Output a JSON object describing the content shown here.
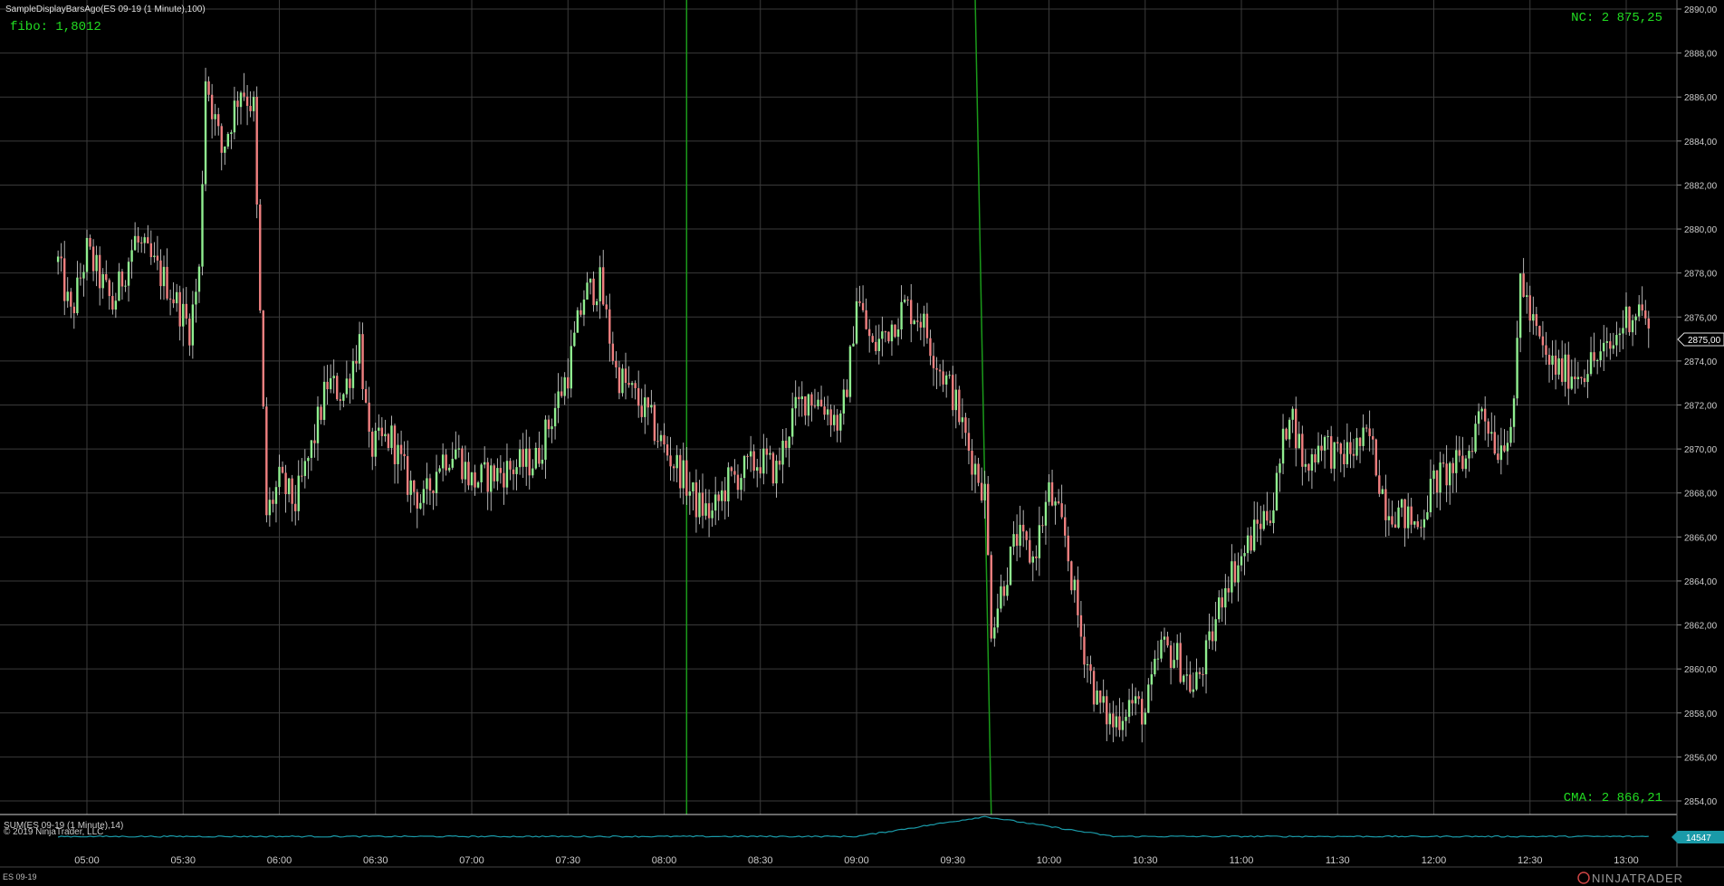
{
  "header": {
    "indicator_title": "SampleDisplayBarsAgo(ES 09-19 (1 Minute),100)",
    "fibo_label": "fibo: 1,8012"
  },
  "labels": {
    "nc": "NC: 2 875,25",
    "cma": "CMA: 2 866,21",
    "current_price": "2875,00"
  },
  "lower_panel": {
    "title": "SUM(ES 09-19 (1 Minute),14)",
    "copyright": "© 2019 NinjaTrader, LLC",
    "current_value": "14547"
  },
  "footer": {
    "instrument": "ES 09-19",
    "brand": "NINJATRADER"
  },
  "colors": {
    "background": "#000000",
    "grid": "#3a3a3a",
    "up_candle": "#90ee90",
    "down_candle": "#f08080",
    "wick": "#dddddd",
    "green_text": "#22dd22",
    "green_line": "#1a9a1a",
    "sum_line": "#1a9aa8",
    "axis_text": "#cccccc"
  },
  "price_axis": {
    "ticks": [
      "2890,00",
      "2888,00",
      "2886,00",
      "2884,00",
      "2882,00",
      "2880,00",
      "2878,00",
      "2876,00",
      "2874,00",
      "2872,00",
      "2870,00",
      "2868,00",
      "2866,00",
      "2864,00",
      "2862,00",
      "2860,00",
      "2858,00",
      "2856,00",
      "2854,00"
    ],
    "min": 2854,
    "max": 2890
  },
  "time_axis": {
    "ticks": [
      "05:00",
      "05:30",
      "06:00",
      "06:30",
      "07:00",
      "07:30",
      "08:00",
      "08:30",
      "09:00",
      "09:30",
      "10:00",
      "10:30",
      "11:00",
      "11:30",
      "12:00",
      "12:30",
      "13:00"
    ]
  },
  "chart_data": {
    "type": "candlestick",
    "x_ticks": [
      "05:00",
      "05:30",
      "06:00",
      "06:30",
      "07:00",
      "07:30",
      "08:00",
      "08:30",
      "09:00",
      "09:30",
      "10:00",
      "10:30",
      "11:00",
      "11:30",
      "12:00",
      "12:30",
      "13:00"
    ],
    "ylim": [
      2854,
      2890
    ],
    "keypoints": [
      {
        "t": "04:51",
        "price": 2878.5
      },
      {
        "t": "04:55",
        "price": 2876.0
      },
      {
        "t": "05:00",
        "price": 2879.0
      },
      {
        "t": "05:08",
        "price": 2876.5
      },
      {
        "t": "05:15",
        "price": 2879.5
      },
      {
        "t": "05:25",
        "price": 2877.5
      },
      {
        "t": "05:32",
        "price": 2875.5
      },
      {
        "t": "05:35",
        "price": 2878.0
      },
      {
        "t": "05:37",
        "price": 2887.0
      },
      {
        "t": "05:42",
        "price": 2883.5
      },
      {
        "t": "05:48",
        "price": 2886.5
      },
      {
        "t": "05:52",
        "price": 2885.5
      },
      {
        "t": "05:54",
        "price": 2876.0
      },
      {
        "t": "05:56",
        "price": 2867.0
      },
      {
        "t": "06:00",
        "price": 2868.5
      },
      {
        "t": "06:05",
        "price": 2867.5
      },
      {
        "t": "06:10",
        "price": 2870.0
      },
      {
        "t": "06:15",
        "price": 2873.0
      },
      {
        "t": "06:20",
        "price": 2872.5
      },
      {
        "t": "06:25",
        "price": 2875.0
      },
      {
        "t": "06:28",
        "price": 2870.0
      },
      {
        "t": "06:35",
        "price": 2870.5
      },
      {
        "t": "06:40",
        "price": 2868.5
      },
      {
        "t": "06:45",
        "price": 2867.5
      },
      {
        "t": "06:50",
        "price": 2869.5
      },
      {
        "t": "06:55",
        "price": 2870.0
      },
      {
        "t": "07:00",
        "price": 2868.5
      },
      {
        "t": "07:10",
        "price": 2869.0
      },
      {
        "t": "07:20",
        "price": 2869.5
      },
      {
        "t": "07:25",
        "price": 2871.5
      },
      {
        "t": "07:30",
        "price": 2873.5
      },
      {
        "t": "07:35",
        "price": 2877.0
      },
      {
        "t": "07:40",
        "price": 2877.5
      },
      {
        "t": "07:45",
        "price": 2873.5
      },
      {
        "t": "07:50",
        "price": 2872.5
      },
      {
        "t": "07:55",
        "price": 2871.5
      },
      {
        "t": "08:00",
        "price": 2870.0
      },
      {
        "t": "08:05",
        "price": 2869.0
      },
      {
        "t": "08:10",
        "price": 2867.5
      },
      {
        "t": "08:15",
        "price": 2867.0
      },
      {
        "t": "08:20",
        "price": 2868.5
      },
      {
        "t": "08:25",
        "price": 2869.0
      },
      {
        "t": "08:30",
        "price": 2869.5
      },
      {
        "t": "08:35",
        "price": 2869.0
      },
      {
        "t": "08:40",
        "price": 2871.5
      },
      {
        "t": "08:45",
        "price": 2872.5
      },
      {
        "t": "08:50",
        "price": 2872.0
      },
      {
        "t": "08:55",
        "price": 2871.0
      },
      {
        "t": "08:58",
        "price": 2874.0
      },
      {
        "t": "09:00",
        "price": 2877.0
      },
      {
        "t": "09:05",
        "price": 2874.5
      },
      {
        "t": "09:10",
        "price": 2875.5
      },
      {
        "t": "09:15",
        "price": 2876.5
      },
      {
        "t": "09:20",
        "price": 2876.0
      },
      {
        "t": "09:25",
        "price": 2874.0
      },
      {
        "t": "09:30",
        "price": 2872.5
      },
      {
        "t": "09:35",
        "price": 2870.0
      },
      {
        "t": "09:40",
        "price": 2868.0
      },
      {
        "t": "09:42",
        "price": 2862.0
      },
      {
        "t": "09:45",
        "price": 2863.5
      },
      {
        "t": "09:50",
        "price": 2866.0
      },
      {
        "t": "09:55",
        "price": 2865.0
      },
      {
        "t": "10:00",
        "price": 2868.0
      },
      {
        "t": "10:05",
        "price": 2866.0
      },
      {
        "t": "10:10",
        "price": 2861.5
      },
      {
        "t": "10:15",
        "price": 2858.5
      },
      {
        "t": "10:20",
        "price": 2857.5
      },
      {
        "t": "10:25",
        "price": 2858.5
      },
      {
        "t": "10:30",
        "price": 2858.0
      },
      {
        "t": "10:35",
        "price": 2861.0
      },
      {
        "t": "10:40",
        "price": 2860.5
      },
      {
        "t": "10:45",
        "price": 2859.0
      },
      {
        "t": "10:50",
        "price": 2861.0
      },
      {
        "t": "10:55",
        "price": 2864.0
      },
      {
        "t": "11:00",
        "price": 2865.0
      },
      {
        "t": "11:05",
        "price": 2866.5
      },
      {
        "t": "11:10",
        "price": 2867.5
      },
      {
        "t": "11:15",
        "price": 2872.0
      },
      {
        "t": "11:20",
        "price": 2869.0
      },
      {
        "t": "11:25",
        "price": 2870.5
      },
      {
        "t": "11:30",
        "price": 2869.5
      },
      {
        "t": "11:35",
        "price": 2870.0
      },
      {
        "t": "11:40",
        "price": 2870.5
      },
      {
        "t": "11:45",
        "price": 2867.5
      },
      {
        "t": "11:50",
        "price": 2867.0
      },
      {
        "t": "11:55",
        "price": 2866.5
      },
      {
        "t": "12:00",
        "price": 2868.5
      },
      {
        "t": "12:05",
        "price": 2869.0
      },
      {
        "t": "12:10",
        "price": 2869.5
      },
      {
        "t": "12:15",
        "price": 2872.0
      },
      {
        "t": "12:20",
        "price": 2870.0
      },
      {
        "t": "12:25",
        "price": 2871.5
      },
      {
        "t": "12:27",
        "price": 2878.0
      },
      {
        "t": "12:30",
        "price": 2876.0
      },
      {
        "t": "12:35",
        "price": 2874.0
      },
      {
        "t": "12:40",
        "price": 2873.5
      },
      {
        "t": "12:45",
        "price": 2873.5
      },
      {
        "t": "12:50",
        "price": 2874.0
      },
      {
        "t": "12:55",
        "price": 2874.5
      },
      {
        "t": "13:00",
        "price": 2876.0
      },
      {
        "t": "13:05",
        "price": 2876.5
      },
      {
        "t": "13:07",
        "price": 2875.0
      }
    ],
    "vertical_lines": [
      {
        "t": "08:07"
      },
      {
        "t": "09:37",
        "t_end": "09:42"
      }
    ],
    "sum_indicator": {
      "current_value": 14547,
      "peak_time": "09:40"
    }
  }
}
